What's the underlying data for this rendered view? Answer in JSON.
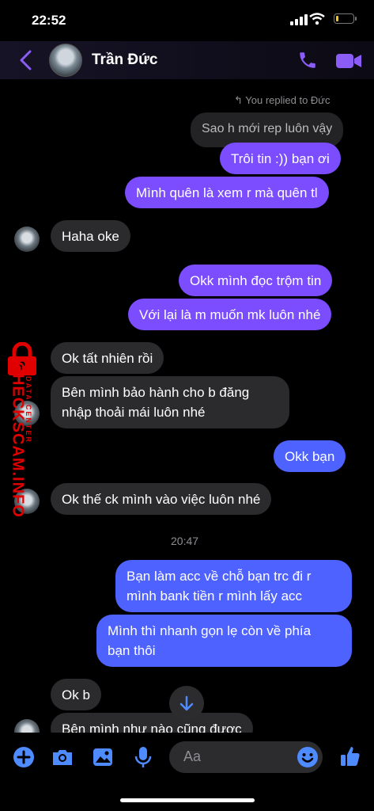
{
  "status": {
    "time": "22:52"
  },
  "header": {
    "name": "Trần Đức"
  },
  "replied_label": "You replied to Đức",
  "messages": {
    "quoted": "Sao h mới rep luôn vậy",
    "m1": "Trôi tin :)) bạn ơi",
    "m2": "Mình quên là xem r mà quên tl",
    "m3": "Haha oke",
    "m4": "Okk mình đọc trộm tin",
    "m5": "Với lại là m muốn mk luôn nhé",
    "m6": "Ok tất nhiên rồi",
    "m7": "Bên mình bảo hành cho b đăng\nnhập thoải mái luôn nhé",
    "m8": "Okk bạn",
    "m9": "Ok thế ck mình vào việc luôn nhé",
    "time_sep": "20:47",
    "m10": "Bạn làm acc về chỗ bạn trc đi r\nmình bank tiền r mình lấy acc",
    "m11": "Mình thì nhanh gọn lẹ còn về phía\nbạn thôi",
    "m12": "Ok b",
    "m13": "Bên mình như nào cũng được"
  },
  "watermark": {
    "main": "CHECKSCAM.INFO",
    "sub": "DATA CENTER"
  },
  "composer": {
    "placeholder": "Aa"
  },
  "colors": {
    "accent": "#8b5cf6",
    "outgoing": "#7b4dff",
    "outgoing_blue": "#4e62ff",
    "incoming": "#2b2b2e"
  }
}
